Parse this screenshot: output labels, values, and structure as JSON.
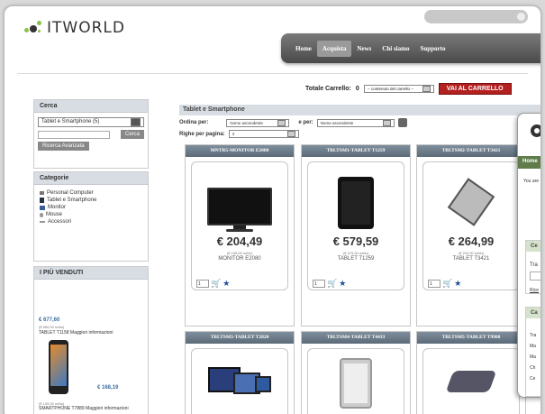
{
  "logo": {
    "text": "ITWORLD"
  },
  "nav": {
    "items": [
      {
        "label": "Home"
      },
      {
        "label": "Acquista"
      },
      {
        "label": "News"
      },
      {
        "label": "Chi siamo"
      },
      {
        "label": "Supporto"
      }
    ],
    "active_index": 1
  },
  "cart": {
    "label": "Totale Carrello:",
    "count": "0",
    "select_value": "-- contenuto del carrello --",
    "go_button": "VAI AL CARRELLO"
  },
  "search": {
    "title": "Cerca",
    "category_value": "Tablet e Smartphone (5)",
    "search_button": "Cerca",
    "advanced_button": "Ricerca Avanzata"
  },
  "categories": {
    "title": "Categorie",
    "items": [
      {
        "label": "Personal Computer",
        "icon": "pc-icon"
      },
      {
        "label": "Tablet e Smartphone",
        "icon": "tablet-icon"
      },
      {
        "label": "Monitor",
        "icon": "monitor-icon"
      },
      {
        "label": "Mouse",
        "icon": "mouse-icon"
      },
      {
        "label": "Accessori",
        "icon": "accessories-icon"
      }
    ]
  },
  "bestsellers": {
    "title": "I PIÙ VENDUTI",
    "items": [
      {
        "price": "€ 677,60",
        "netto": "(€ 560,00 netto)",
        "name": "TABLET T1158 Maggiori informazioni"
      },
      {
        "price": "€ 168,19",
        "netto": "(€ 139,00 netto)",
        "name": "SMARTPHONE T7889 Maggiori informazioni"
      }
    ]
  },
  "main": {
    "title": "Tablet e Smartphone",
    "order_label": "Ordina per:",
    "order_value": "Nome ascendente",
    "and_label": "e per:",
    "and_value": "Nome ascendente",
    "rows_label": "Righe per pagina:",
    "rows_value": "3"
  },
  "products": [
    {
      "header": "MNTR5-MONITOR E2080",
      "price": "€ 204,49",
      "netto": "(€ 169,00 netto)",
      "name": "MONITOR E2080",
      "qty": "1"
    },
    {
      "header": "TBLTSM1-TABLET T1259",
      "price": "€ 579,59",
      "netto": "(€ 479,00 netto)",
      "name": "TABLET T1259",
      "qty": "1"
    },
    {
      "header": "TBLTSM2-TABLET T3421",
      "price": "€ 264,99",
      "netto": "(€ 219,00 netto)",
      "name": "TABLET T3421",
      "qty": "1"
    },
    {
      "header": "TBLTSM3-TABLET T2820"
    },
    {
      "header": "TBLTSM4-TABLET T4433"
    },
    {
      "header": "TBLTSM5-TABLET T9988"
    }
  ],
  "overlay": {
    "nav": "Home",
    "you_are": "You are",
    "panel1": "Ce",
    "panel1_value": "Tra",
    "panel1_link": "Rice",
    "panel2": "Ca",
    "panel2_items": [
      "Tra",
      "Ma",
      "Ma",
      "Ch",
      "Ce"
    ]
  },
  "colors": {
    "accent_red": "#b32020",
    "nav_dark": "#4a4a4a",
    "header_blue": "#5c6b79",
    "overlay_green": "#5f7c4a"
  }
}
